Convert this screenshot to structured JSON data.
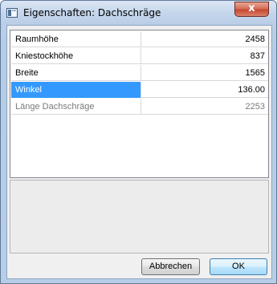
{
  "window": {
    "title": "Eigenschaften: Dachschräge",
    "close_glyph": "x"
  },
  "properties": [
    {
      "name": "Raumhöhe",
      "value": "2458",
      "state": "normal"
    },
    {
      "name": "Kniestockhöhe",
      "value": "837",
      "state": "normal"
    },
    {
      "name": "Breite",
      "value": "1565",
      "state": "normal"
    },
    {
      "name": "Winkel",
      "value": "136.00",
      "state": "selected"
    },
    {
      "name": "Länge Dachschräge",
      "value": "2253",
      "state": "readonly"
    }
  ],
  "description": "",
  "buttons": {
    "cancel_label": "Abbrechen",
    "ok_label": "OK"
  },
  "colors": {
    "selection": "#3399ff",
    "readonly_text": "#7a7a7a",
    "close_button": "#c7472f"
  }
}
